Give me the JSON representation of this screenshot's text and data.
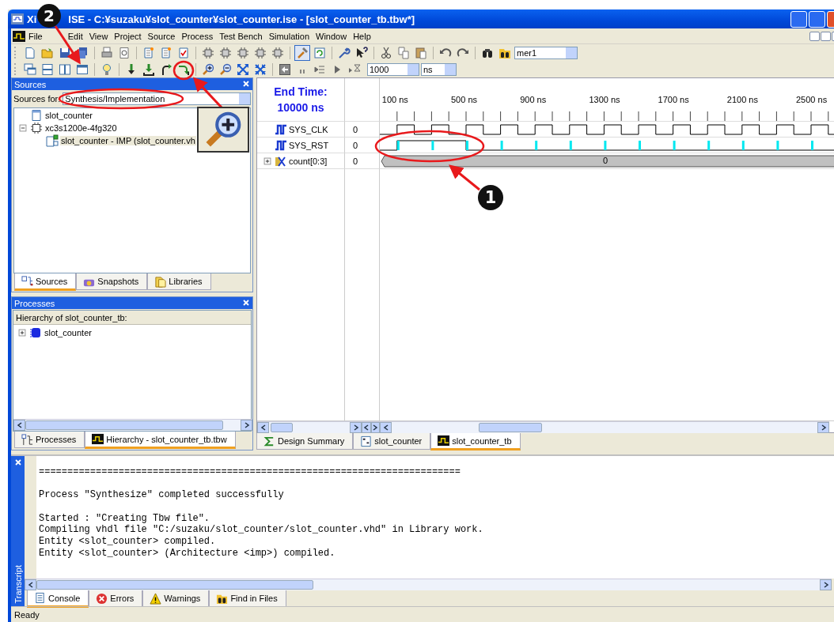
{
  "window": {
    "title_start": "Xi",
    "title": "ISE - C:¥suzaku¥slot_counter¥slot_counter.ise - [slot_counter_tb.tbw*]"
  },
  "menu": [
    "File",
    "Edit",
    "View",
    "Project",
    "Source",
    "Process",
    "Test Bench",
    "Simulation",
    "Window",
    "Help"
  ],
  "toolbar": {
    "search_combo": "mer1",
    "time_value": "1000",
    "time_unit": "ns"
  },
  "sources_panel": {
    "title": "Sources",
    "sources_for_label": "Sources for:",
    "sources_for_value": "Synthesis/Implementation",
    "tree": [
      {
        "label": "slot_counter",
        "kind": "file",
        "selected": false
      },
      {
        "label": "xc3s1200e-4fg320",
        "kind": "device",
        "selected": false,
        "expanded": true,
        "children": [
          {
            "label": "slot_counter - IMP (slot_counter.vh",
            "kind": "module",
            "selected": true
          }
        ]
      }
    ],
    "tabs": [
      {
        "label": "Sources",
        "kind": "sources",
        "selected": true
      },
      {
        "label": "Snapshots",
        "kind": "snapshots",
        "selected": false
      },
      {
        "label": "Libraries",
        "kind": "libraries",
        "selected": false
      }
    ]
  },
  "processes_panel": {
    "title": "Processes",
    "hierarchy_label": "Hierarchy of slot_counter_tb:",
    "tree": [
      {
        "label": "slot_counter",
        "kind": "component",
        "selected": false,
        "expanded": false
      }
    ],
    "tabs": [
      {
        "label": "Processes",
        "kind": "processes",
        "selected": false
      },
      {
        "label": "Hierarchy - slot_counter_tb.tbw",
        "kind": "wave",
        "selected": true
      }
    ]
  },
  "waveform": {
    "end_time_label": "End Time:",
    "end_time_value": "10000 ns",
    "time_labels": [
      "100 ns",
      "500 ns",
      "900 ns",
      "1300 ns",
      "1700 ns",
      "2100 ns",
      "2500 ns"
    ],
    "signals": [
      {
        "name": "SYS_CLK",
        "value": "0",
        "kind": "clock"
      },
      {
        "name": "SYS_RST",
        "value": "0",
        "kind": "reset"
      },
      {
        "name": "count[0:3]",
        "value": "0",
        "kind": "bus",
        "bus_value": "0",
        "expanded": false
      }
    ]
  },
  "editor_tabs": [
    {
      "label": "Design Summary",
      "kind": "summary",
      "selected": false
    },
    {
      "label": "slot_counter",
      "kind": "vhdl",
      "selected": false
    },
    {
      "label": "slot_counter_tb",
      "kind": "wave",
      "selected": true
    }
  ],
  "console": {
    "side_title": "Transcript",
    "blocks": [
      [
        "=========================================================================="
      ],
      [
        "Process \"Synthesize\" completed successfully"
      ],
      [
        "Started : \"Creating Tbw file\".",
        "Compiling vhdl file \"C:/suzaku/slot_counter/slot_counter.vhd\" in Library work.",
        "Entity <slot_counter> compiled.",
        "Entity <slot_counter> (Architecture <imp>) compiled."
      ]
    ],
    "tabs": [
      {
        "label": "Console",
        "kind": "console",
        "selected": true
      },
      {
        "label": "Errors",
        "kind": "errors",
        "selected": false
      },
      {
        "label": "Warnings",
        "kind": "warnings",
        "selected": false
      },
      {
        "label": "Find in Files",
        "kind": "find",
        "selected": false
      }
    ]
  },
  "status_bar": "Ready",
  "annotations": [
    {
      "label": "2"
    },
    {
      "label": "1"
    }
  ]
}
